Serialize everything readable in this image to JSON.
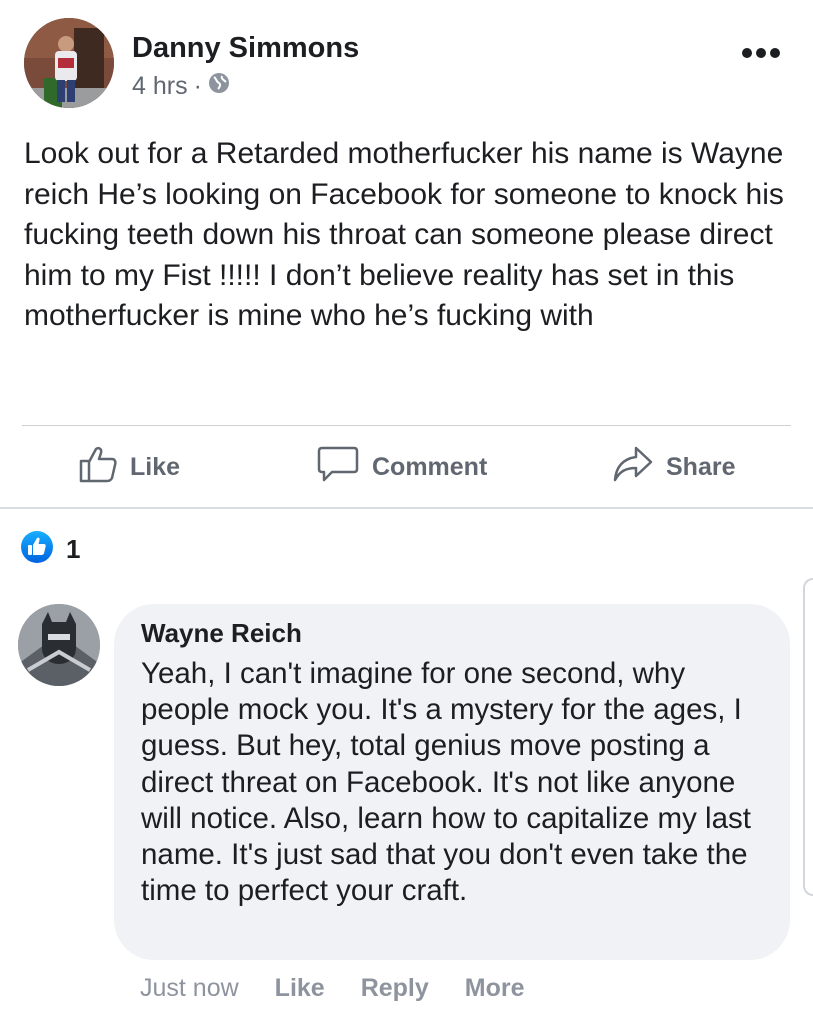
{
  "post": {
    "author": "Danny Simmons",
    "timestamp": "4 hrs",
    "separator": "·",
    "privacy_icon": "globe-icon",
    "text": "Look out for a Retarded motherfucker his name is Wayne reich He’s looking on Facebook for someone to knock his fucking teeth down his throat can someone please direct him to my Fist !!!!! I don’t believe reality has set in this motherfucker is mine who he’s fucking with",
    "more_icon": "more-dots-icon"
  },
  "actions": {
    "like_label": "Like",
    "comment_label": "Comment",
    "share_label": "Share"
  },
  "reactions": {
    "icon": "like-reaction-icon",
    "count": "1"
  },
  "comment": {
    "author": "Wayne Reich",
    "text": "Yeah, I can't imagine for one second, why people mock you. It's a mystery for the ages, I guess. But hey, total genius move posting a direct threat on Facebook. It's not like anyone will notice. Also, learn how to capitalize my last name. It's just sad that you don't even take the time to perfect your craft.",
    "time": "Just now",
    "like_label": "Like",
    "reply_label": "Reply",
    "more_label": "More"
  },
  "colors": {
    "text": "#1c1e21",
    "secondary": "#606770",
    "muted": "#8d949e",
    "bubble": "#f0f2f5",
    "like_blue": "#1877f2"
  }
}
